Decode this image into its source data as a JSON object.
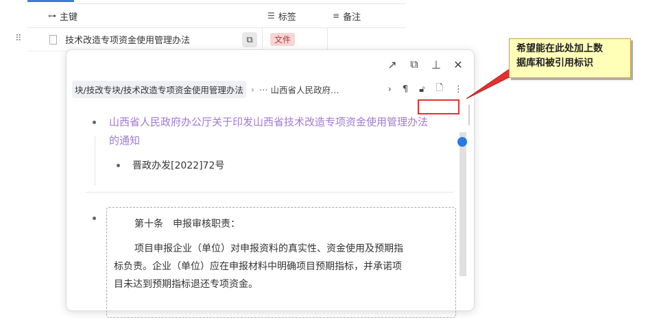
{
  "table": {
    "columns": [
      {
        "icon": "key-icon",
        "label": "主键"
      },
      {
        "icon": "list-icon",
        "label": "标签"
      },
      {
        "icon": "align-left-icon",
        "label": "备注"
      }
    ],
    "rows": [
      {
        "title": "技术改造专项资金使用管理办法",
        "tag": "文件"
      }
    ]
  },
  "popover": {
    "breadcrumb_path": "块/技改专块/技术改造专项资金使用管理办法",
    "breadcrumb_doc": "山西省人民政府…",
    "title_line1": "山西省人民政府办公厅关于印发山西省技术改造专项资金使用管理办法",
    "title_line2": "的通知",
    "doc_number": "晋政办发[2022]72号",
    "quote": {
      "line1": "第十条　申报审核职责：",
      "line2": "项目申报企业（单位）对申报资料的真实性、资金使用及预期指",
      "line3": "标负责。企业（单位）应在申报材料中明确项目预期指标，并承诺项",
      "line4": "目未达到预期指标退还专项资金。"
    }
  },
  "callout": {
    "line1": "希望能在此处加上数",
    "line2": "据库和被引用标识"
  },
  "colors": {
    "link_purple": "#a07ad0",
    "accent_blue": "#2679e6",
    "annotation_red": "#e53030",
    "callout_bg": "#ffffb8",
    "tag_bg": "#f8d6d6"
  }
}
